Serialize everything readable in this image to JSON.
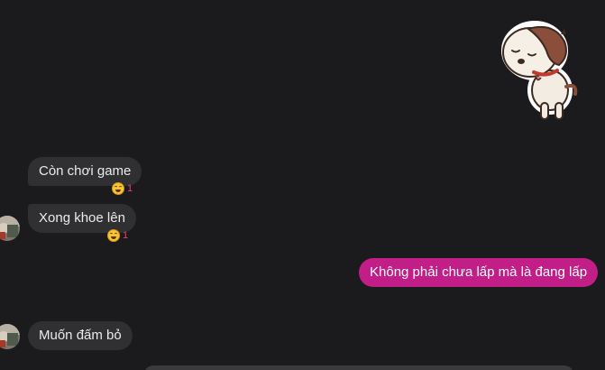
{
  "messages": [
    {
      "direction": "incoming",
      "text": "Còn chơi game",
      "reaction": {
        "emoji": "grinning-face",
        "count": "1"
      }
    },
    {
      "direction": "incoming",
      "text": "Xong khoe lên",
      "reaction": {
        "emoji": "grinning-face",
        "count": "1"
      }
    },
    {
      "direction": "outgoing",
      "text": "Không phải chưa lấp mà là đang lấp"
    },
    {
      "direction": "incoming",
      "text": "Muốn đấm bỏ"
    }
  ],
  "sticker": {
    "icon": "puppy-sticker-icon"
  },
  "colors": {
    "background": "#1b1b1d",
    "incoming_bubble": "#303033",
    "outgoing_bubble": "#c21e88",
    "reaction_count": "#e0447a"
  }
}
